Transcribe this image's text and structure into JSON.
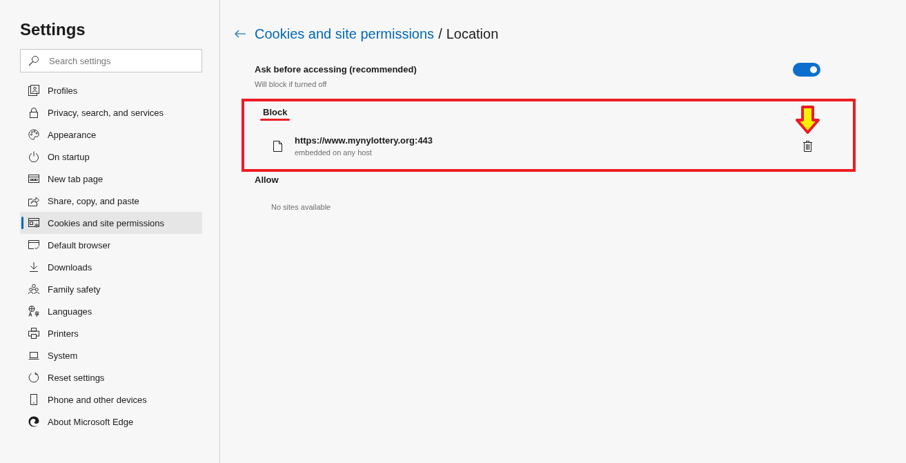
{
  "sidebar": {
    "title": "Settings",
    "search": {
      "placeholder": "Search settings"
    },
    "items": [
      {
        "label": "Profiles",
        "selected": false
      },
      {
        "label": "Privacy, search, and services",
        "selected": false
      },
      {
        "label": "Appearance",
        "selected": false
      },
      {
        "label": "On startup",
        "selected": false
      },
      {
        "label": "New tab page",
        "selected": false
      },
      {
        "label": "Share, copy, and paste",
        "selected": false
      },
      {
        "label": "Cookies and site permissions",
        "selected": true
      },
      {
        "label": "Default browser",
        "selected": false
      },
      {
        "label": "Downloads",
        "selected": false
      },
      {
        "label": "Family safety",
        "selected": false
      },
      {
        "label": "Languages",
        "selected": false
      },
      {
        "label": "Printers",
        "selected": false
      },
      {
        "label": "System",
        "selected": false
      },
      {
        "label": "Reset settings",
        "selected": false
      },
      {
        "label": "Phone and other devices",
        "selected": false
      },
      {
        "label": "About Microsoft Edge",
        "selected": false
      }
    ]
  },
  "main": {
    "breadcrumb": {
      "parent": "Cookies and site permissions",
      "separator": "/",
      "current": "Location"
    },
    "setting": {
      "label": "Ask before accessing (recommended)",
      "description": "Will block if turned off",
      "on": true
    },
    "sections": [
      {
        "title": "Block",
        "highlighted": true,
        "sites": [
          {
            "url": "https://www.mynylottery.org:443",
            "detail": "embedded on any host",
            "marked": true
          }
        ]
      },
      {
        "title": "Allow",
        "highlighted": false,
        "empty_text": "No sites available"
      }
    ]
  }
}
